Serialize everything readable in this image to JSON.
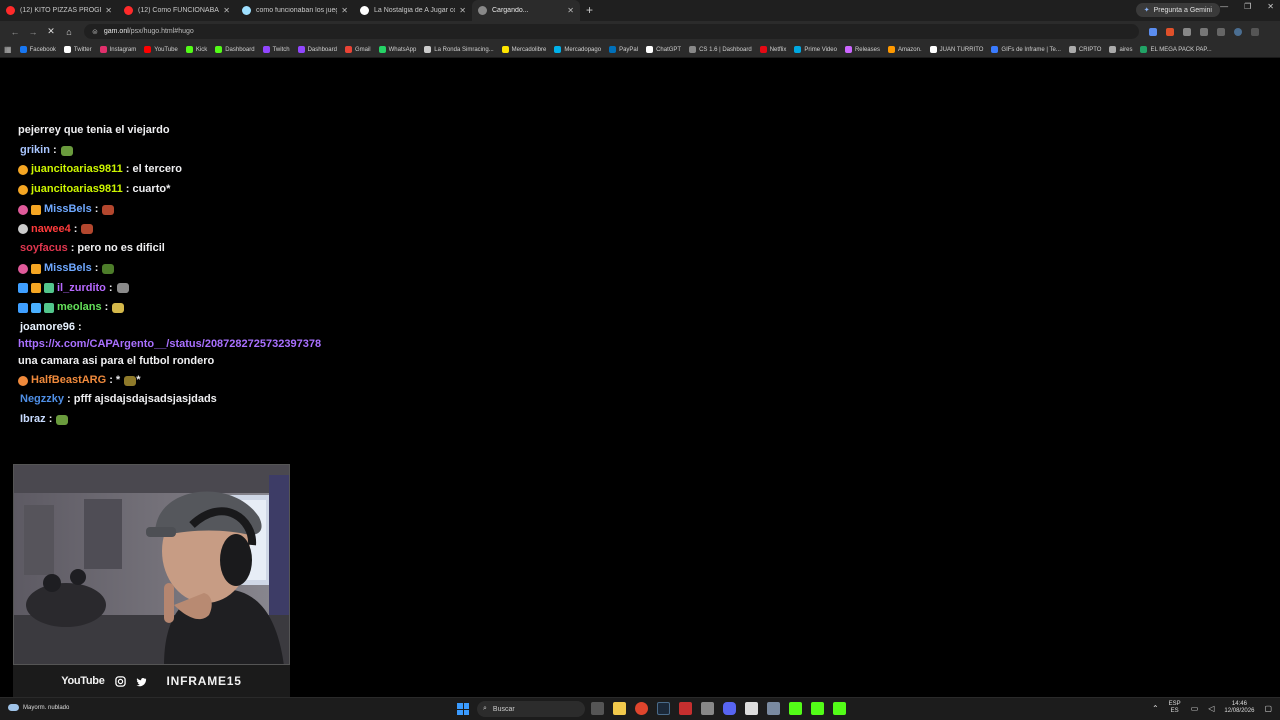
{
  "browser": {
    "tabs": [
      {
        "title": "(12) KITO PIZZAS PROGRAMA",
        "favicon_color": "#ff2a2a",
        "active": false
      },
      {
        "title": "(12) Como FUNCIONABAN los",
        "favicon_color": "#ff2a2a",
        "active": false
      },
      {
        "title": "como funcionaban los juegos d",
        "favicon_color": "#9fe0ff",
        "active": false
      },
      {
        "title": "La Nostalgia de A Jugar con H",
        "favicon_color": "#ffffff",
        "active": false
      },
      {
        "title": "Cargando...",
        "favicon_color": "#888888",
        "active": true
      }
    ],
    "new_tab_icon": "plus-icon",
    "gemini_label": "Pregunta a Gemini",
    "url_host": "gam.onl",
    "url_path": "/psx/hugo.html#hugo",
    "bookmarks": [
      {
        "label": "Facebook",
        "color": "#1877f2"
      },
      {
        "label": "Twitter",
        "color": "#ffffff"
      },
      {
        "label": "Instagram",
        "color": "#e1306c"
      },
      {
        "label": "YouTube",
        "color": "#ff0000"
      },
      {
        "label": "Kick",
        "color": "#53fc18"
      },
      {
        "label": "Dashboard",
        "color": "#53fc18"
      },
      {
        "label": "Twitch",
        "color": "#9146ff"
      },
      {
        "label": "Dashboard",
        "color": "#9146ff"
      },
      {
        "label": "Gmail",
        "color": "#ea4335"
      },
      {
        "label": "WhatsApp",
        "color": "#25d366"
      },
      {
        "label": "La Ronda Simracing...",
        "color": "#cccccc"
      },
      {
        "label": "Mercadolibre",
        "color": "#ffe600"
      },
      {
        "label": "Mercadopago",
        "color": "#00b1ea"
      },
      {
        "label": "PayPal",
        "color": "#0070ba"
      },
      {
        "label": "ChatGPT",
        "color": "#ffffff"
      },
      {
        "label": "CS 1.6 | Dashboard",
        "color": "#888888"
      },
      {
        "label": "Netflix",
        "color": "#e50914"
      },
      {
        "label": "Prime Video",
        "color": "#00a8e1"
      },
      {
        "label": "Releases",
        "color": "#cc66ff"
      },
      {
        "label": "Amazon.",
        "color": "#ff9900"
      },
      {
        "label": "JUAN TURRITO",
        "color": "#ffffff"
      },
      {
        "label": "GIFs de Inframe | Te...",
        "color": "#3a7bff"
      },
      {
        "label": "CRIPTO",
        "color": "#aaaaaa"
      },
      {
        "label": "aires",
        "color": "#aaaaaa"
      },
      {
        "label": "EL MEGA PACK PAP...",
        "color": "#21a366"
      }
    ]
  },
  "chat": {
    "lines": [
      {
        "text": "pejerrey que tenia el viejardo"
      },
      {
        "badges": [],
        "user": "grikin",
        "user_color": "#a9c6ff",
        "emote_color": "#6a9b3d"
      },
      {
        "badges": [
          "#f5a623"
        ],
        "user": "juancitoarias9811",
        "user_color": "#ccf500",
        "message": ": el tercero"
      },
      {
        "badges": [
          "#f5a623"
        ],
        "user": "juancitoarias9811",
        "user_color": "#ccf500",
        "message": ": cuarto*"
      },
      {
        "badges": [
          "#e05a9a",
          "#f5a623"
        ],
        "user": "MissBels",
        "user_color": "#6fa8ff",
        "emote_color": "#b3472e"
      },
      {
        "badges": [
          "#cccccc"
        ],
        "user": "nawee4",
        "user_color": "#ff3b3b",
        "emote_color": "#b3472e"
      },
      {
        "badges": [],
        "user": "soyfacus",
        "user_color": "#e0364f",
        "message": ": pero no es dificil"
      },
      {
        "badges": [
          "#e05a9a",
          "#f5a623"
        ],
        "user": "MissBels",
        "user_color": "#6fa8ff",
        "emote_color": "#4d7d2a"
      },
      {
        "badges": [
          "#3f9fff",
          "#f5a623",
          "#53c68c"
        ],
        "user": "il_zurdito",
        "user_color": "#b769ff",
        "emote_color": "#8a8a8a"
      },
      {
        "badges": [
          "#3f9fff",
          "#4ab0ff",
          "#53c68c"
        ],
        "user": "meolans",
        "user_color": "#64e05a",
        "emote_color": "#d4b84a"
      },
      {
        "badges": [],
        "user": "joamore96",
        "user_color": "#e8f2ff",
        "message": ":"
      },
      {
        "link": "https://x.com/CAPArgento__/status/2087282725732397378",
        "message": " una camara asi para el futbol rondero"
      },
      {
        "badges": [
          "#f08a3c"
        ],
        "user": "HalfBeastARG",
        "user_color": "#f08a3c",
        "message": ": *",
        "emote_color": "#8f7a2a",
        "tail": "*"
      },
      {
        "badges": [],
        "user": "Negzzky",
        "user_color": "#4f8fe6",
        "message": ": pfff ajsdajsdajsadsjasjdads"
      },
      {
        "badges": [],
        "user": "Ibraz",
        "user_color": "#c9dcff",
        "emote_color": "#6a9b3d"
      }
    ]
  },
  "stream": {
    "platform_label": "YouTube",
    "brand": "INFRAME15",
    "social_icons": [
      "instagram-icon",
      "twitter-icon"
    ]
  },
  "taskbar": {
    "weather": "Mayorm. nublado",
    "search_placeholder": "Buscar",
    "lang_top": "ESP",
    "lang_bottom": "ES",
    "time": "14:46",
    "date": "12/08/2026"
  }
}
